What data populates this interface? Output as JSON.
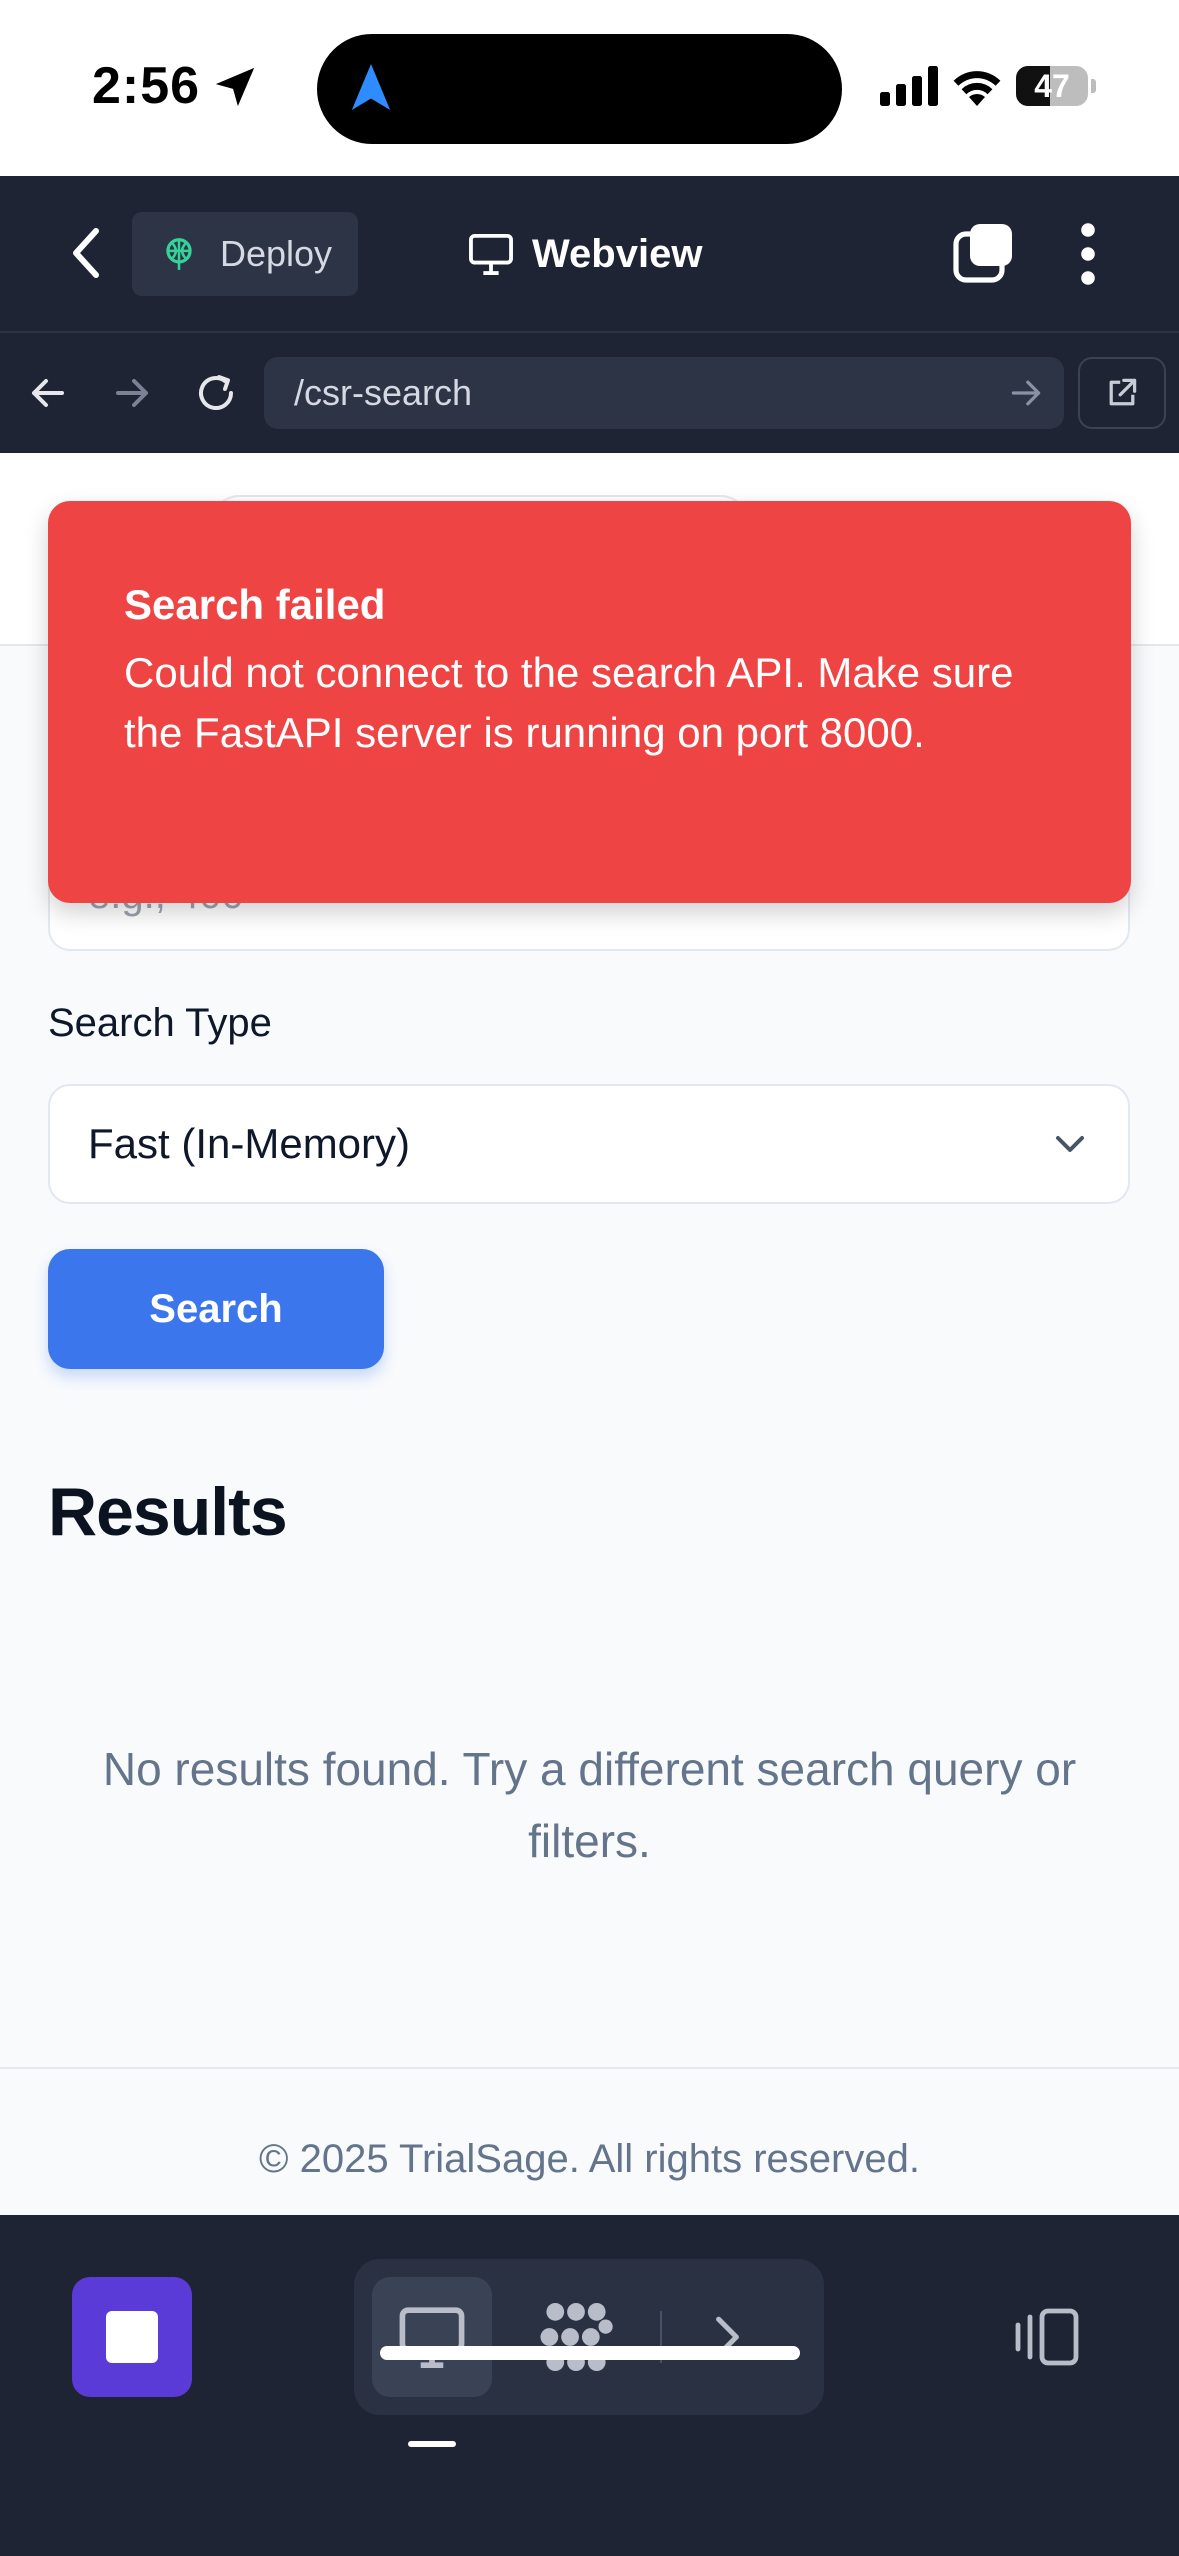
{
  "status_bar": {
    "time": "2:56",
    "battery_percent": "47",
    "battery_level": 0.47
  },
  "header": {
    "deploy_label": "Deploy",
    "title": "Webview"
  },
  "browser": {
    "url": "/csr-search"
  },
  "page": {
    "input_placeholder": "e.g., 400",
    "search_type_label": "Search Type",
    "search_type_value": "Fast (In-Memory)",
    "search_button": "Search",
    "results_heading": "Results",
    "empty_message": "No results found. Try a different search query or filters.",
    "footer": "© 2025 TrialSage. All rights reserved."
  },
  "toast": {
    "title": "Search failed",
    "message": "Could not connect to the search API. Make sure the FastAPI server is running on port 8000."
  },
  "colors": {
    "header_bg": "#1e2433",
    "toast_bg": "#ef4444",
    "primary_button": "#3b76ed",
    "stop_button": "#5b3bd8"
  },
  "icons": {
    "status": [
      "location-arrow-icon",
      "navigation-icon",
      "signal-icon",
      "wifi-icon",
      "battery-icon"
    ],
    "header": [
      "back-chevron-icon",
      "deploy-icon",
      "monitor-icon",
      "tabs-icon",
      "more-vertical-icon"
    ],
    "browser": [
      "back-arrow-icon",
      "forward-arrow-icon",
      "reload-icon",
      "go-arrow-icon",
      "open-external-icon"
    ],
    "toolbar": [
      "stop-icon",
      "monitor-icon",
      "apps-icon",
      "terminal-icon",
      "split-view-icon"
    ]
  }
}
